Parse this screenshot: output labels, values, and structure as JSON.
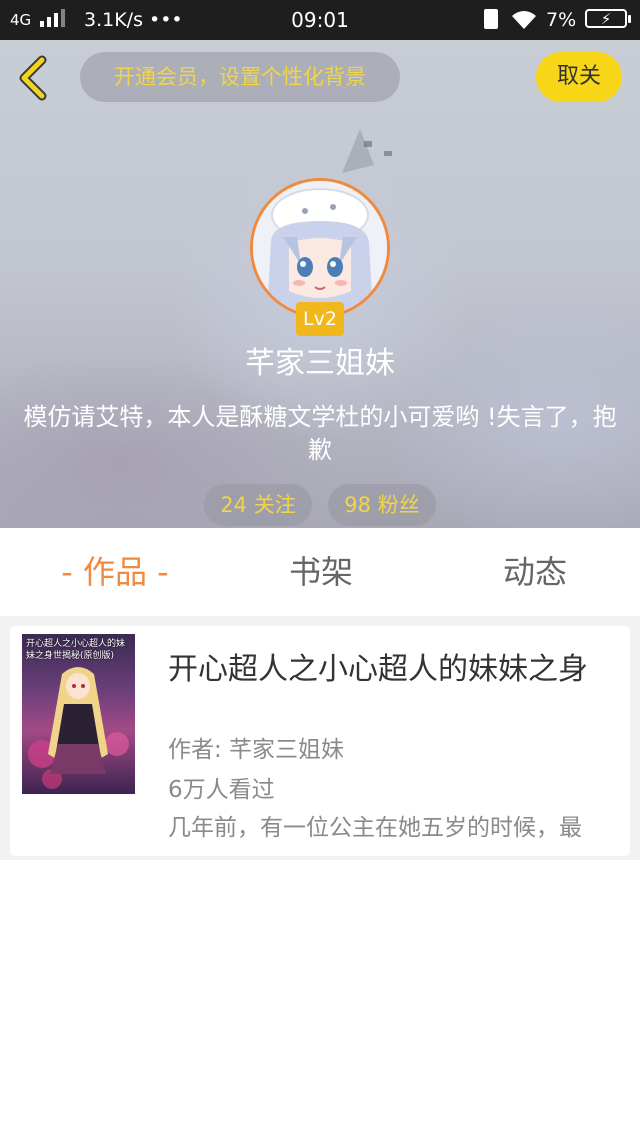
{
  "status_bar": {
    "network": "4G",
    "speed": "3.1K/s •••",
    "time": "09:01",
    "battery": "7%",
    "bolt": "⚡"
  },
  "header": {
    "vip_prompt": "开通会员，设置个性化背景",
    "unfollow_label": "取关",
    "level": "Lv2",
    "username": "芊家三姐妹",
    "bio": "模仿请艾特，本人是酥糖文学杜的小可爱哟 !失言了，抱歉",
    "following": "24 关注",
    "fans": "98 粉丝"
  },
  "tabs": [
    {
      "label": "- 作品 -"
    },
    {
      "label": "书架"
    },
    {
      "label": "动态"
    }
  ],
  "works": [
    {
      "cover_text": "开心超人之小心超人的妹妹之身世揭秘(原创版)",
      "title": "开心超人之小心超人的妹妹之身",
      "author": "作者: 芊家三姐妹",
      "views": "6万人看过",
      "description": "几年前，有一位公主在她五岁的时候，最"
    }
  ],
  "colors": {
    "accent_orange": "#ef8a41",
    "accent_yellow": "#f6d617",
    "pill_text": "#f1d548",
    "level_badge": "#f2b71d"
  },
  "icons": {
    "back": "chevron-left-icon",
    "sim": "sim-card-icon",
    "wifi": "wifi-icon",
    "battery": "battery-icon"
  }
}
